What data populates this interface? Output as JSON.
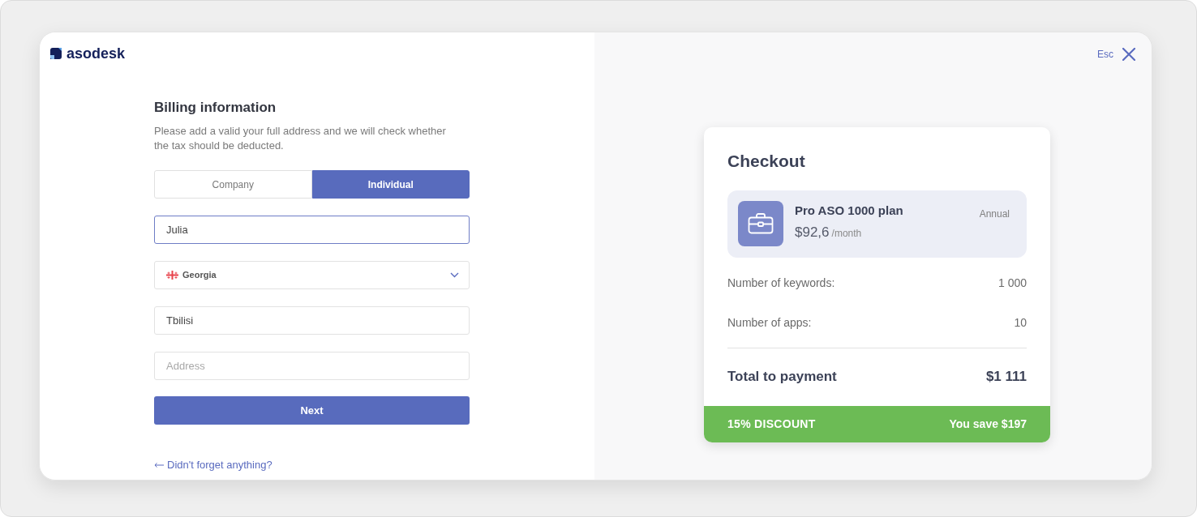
{
  "logo": {
    "text": "asodesk"
  },
  "close": {
    "label": "Esc"
  },
  "billing": {
    "title": "Billing information",
    "description": "Please add a valid your full address and we will check whether the tax should be deducted.",
    "tabs": [
      {
        "label": "Company",
        "selected": false
      },
      {
        "label": "Individual",
        "selected": true
      }
    ],
    "fields": [
      {
        "kind": "text",
        "value": "Julia",
        "focused": true
      },
      {
        "kind": "select",
        "value": "Georgia",
        "focused": false
      },
      {
        "kind": "text",
        "value": "Tbilisi",
        "focused": false
      },
      {
        "kind": "text",
        "placeholder": "Address",
        "focused": false
      }
    ],
    "next_button": "Next",
    "back_link": "Didn't forget anything?"
  },
  "checkout": {
    "title": "Checkout",
    "plan": {
      "name": "Pro ASO 1000 plan",
      "price": "$92,6",
      "period": "/month",
      "billing": "Annual"
    },
    "rows": [
      {
        "label": "Number of keywords:",
        "value": "1 000"
      },
      {
        "label": "Number of apps:",
        "value": "10"
      }
    ],
    "total": {
      "label": "Total to payment",
      "value": "$1 111"
    },
    "discount": {
      "label": "15% DISCOUNT",
      "savings": "You save $197"
    }
  }
}
